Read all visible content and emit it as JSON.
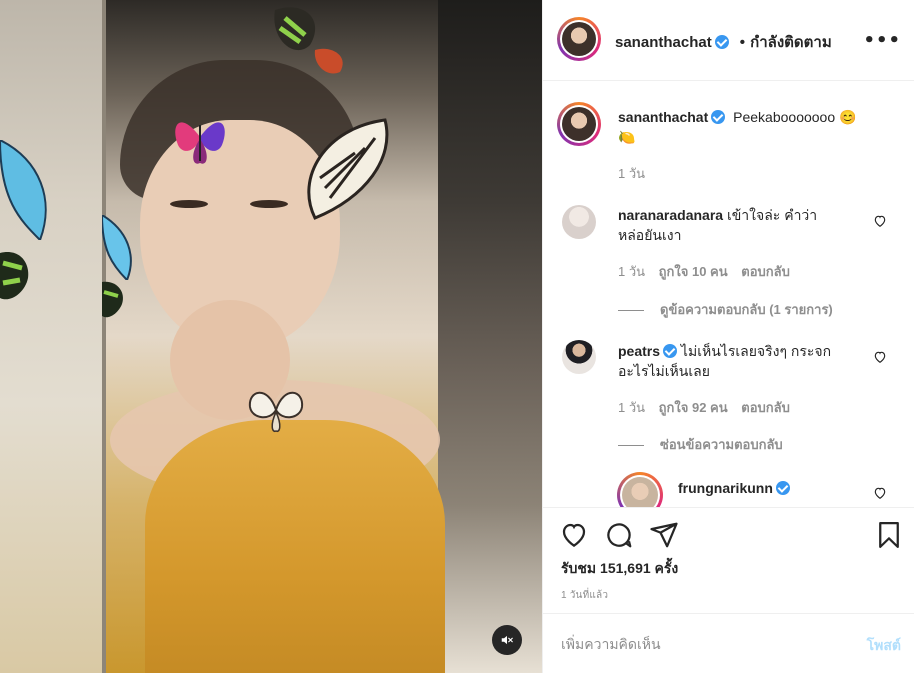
{
  "colors": {
    "accent": "#3897f0",
    "post_disabled": "#b2dffc",
    "text_primary": "#262626",
    "text_secondary": "#8e8e8e",
    "border": "#efefef",
    "story_ring": [
      "#f58529",
      "#dd2a7b",
      "#8134af"
    ]
  },
  "media": {
    "type": "video",
    "mute_icon": "speaker-muted-icon"
  },
  "header": {
    "username": "sananthachat",
    "verified": true,
    "separator": "•",
    "follow_status": "กำลังติดตาม",
    "more_icon": "more-horizontal-icon"
  },
  "caption": {
    "username": "sananthachat",
    "verified": true,
    "text": "Peekabooooooo",
    "emojis": [
      "😊",
      "🍋"
    ],
    "time": "1 วัน"
  },
  "comments": [
    {
      "username": "naranaradanara",
      "verified": false,
      "text": "เข้าใจล่ะ คำว่าหล่อยันเงา",
      "text_line1": "เข้าใจล่ะ คำว่า",
      "text_line2": "หล่อยันเงา",
      "time": "1 วัน",
      "likes": "ถูกใจ 10 คน",
      "reply": "ตอบกลับ",
      "replies_toggle": "ดูข้อความตอบกลับ (1 รายการ)"
    },
    {
      "username": "peatrs",
      "verified": true,
      "text": "ไม่เห็นไรเลยจริงๆ กระจกอะไรไม่เห็นเลย",
      "text_line1": "ไม่เห็นไรเลยจริงๆ กระจก",
      "text_line2": "อะไรไม่เห็นเลย",
      "time": "1 วัน",
      "likes": "ถูกใจ 92 คน",
      "reply": "ตอบกลับ",
      "replies_toggle": "ซ่อนข้อความตอบกลับ",
      "replies": [
        {
          "username": "frungnarikunn",
          "verified": true
        }
      ]
    }
  ],
  "actions": {
    "like_icon": "heart-icon",
    "comment_icon": "comment-icon",
    "share_icon": "paper-plane-icon",
    "save_icon": "bookmark-icon",
    "views_label": "รับชม",
    "views_count": "151,691",
    "views_suffix": "ครั้ง",
    "timestamp": "1 วันที่แล้ว"
  },
  "compose": {
    "placeholder": "เพิ่มความคิดเห็น",
    "post_label": "โพสต์"
  }
}
